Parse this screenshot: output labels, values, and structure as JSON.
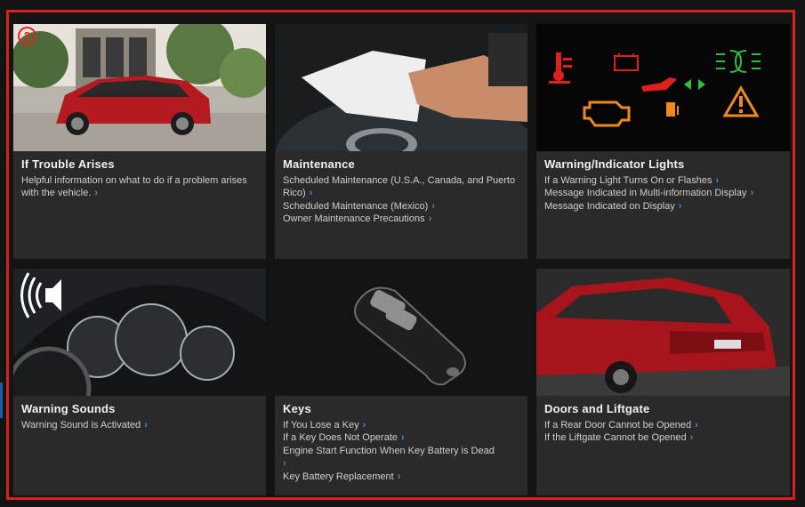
{
  "badge_number": "2",
  "cards": [
    {
      "title": "If Trouble Arises",
      "image": "red-suv-parked-street",
      "links": [
        "Helpful information on what to do if a problem arises with the vehicle."
      ]
    },
    {
      "title": "Maintenance",
      "image": "hand-wiping-dashboard",
      "links": [
        "Scheduled Maintenance (U.S.A., Canada, and Puerto Rico)",
        "Scheduled Maintenance (Mexico)",
        "Owner Maintenance Precautions"
      ]
    },
    {
      "title": "Warning/Indicator Lights",
      "image": "warning-light-icons",
      "links": [
        "If a Warning Light Turns On or Flashes",
        "Message Indicated in Multi-information Display",
        "Message Indicated on Display"
      ]
    },
    {
      "title": "Warning Sounds",
      "image": "instrument-cluster-with-speaker-icon",
      "links": [
        "Warning Sound is Activated"
      ]
    },
    {
      "title": "Keys",
      "image": "smart-key-fob",
      "links": [
        "If You Lose a Key",
        "If a Key Does Not Operate",
        "Engine Start Function When Key Battery is Dead",
        "Key Battery Replacement"
      ]
    },
    {
      "title": "Doors and Liftgate",
      "image": "red-suv-rear-view",
      "links": [
        "If a Rear Door Cannot be Opened",
        "If the Liftgate Cannot be Opened"
      ]
    }
  ],
  "colors": {
    "accent_red": "#e8201c",
    "link_chevron": "#3b8fe0",
    "card_bg": "#2a2a2a",
    "page_bg": "#141414"
  }
}
